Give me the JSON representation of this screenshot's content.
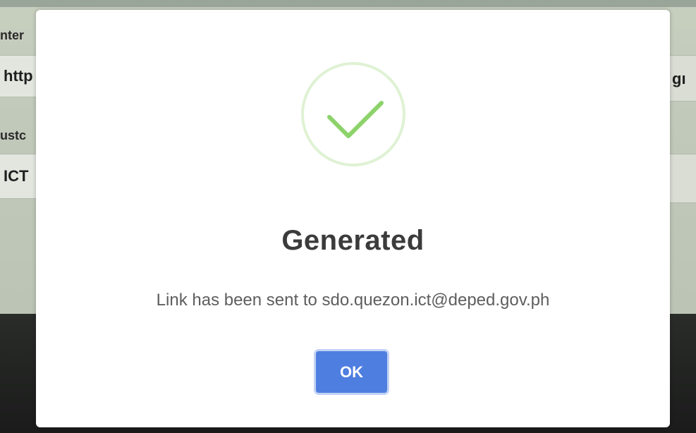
{
  "background": {
    "field1_label": "nter",
    "field1_value": "http",
    "field1_side": "gı",
    "field2_label": "ustc",
    "field2_value": "ICT"
  },
  "dialog": {
    "icon": "check-icon",
    "icon_color": "#8cd36a",
    "title": "Generated",
    "message": "Link has been sent to sdo.quezon.ict@deped.gov.ph",
    "ok_label": "OK",
    "ok_color": "#4e7ee0"
  }
}
